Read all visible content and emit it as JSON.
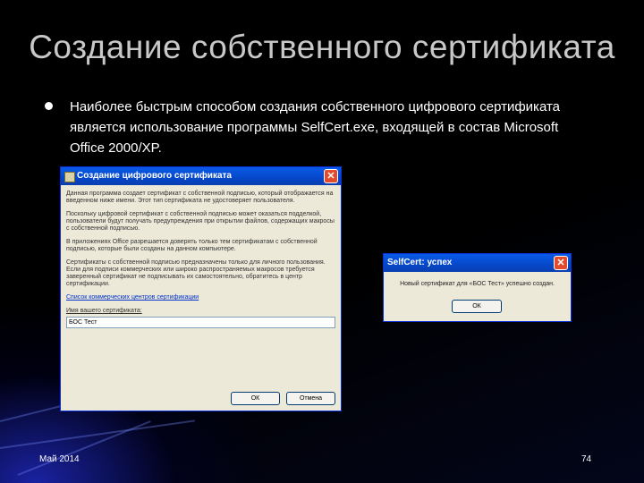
{
  "slide": {
    "title": "Создание собственного сертификата",
    "bullet": "Наиболее быстрым способом создания собственного цифрового сертификата является использование программы SelfCert.exe, входящей в состав Microsoft Office 2000/XP.",
    "footer_date": "Май 2014",
    "page_number": "74"
  },
  "create_dialog": {
    "title": "Создание цифрового сертификата",
    "paragraphs": [
      "Данная программа создает сертификат с собственной подписью, который отображается на введенном ниже имени. Этот тип сертификата не удостоверяет пользователя.",
      "Поскольку цифровой сертификат с собственной подписью может оказаться подделкой, пользователи будут получать предупреждения при открытии файлов, содержащих макросы с собственной подписью.",
      "В приложениях Office разрешается доверять только тем сертификатам с собственной подписью, которые были созданы на данном компьютере.",
      "Сертификаты с собственной подписью предназначены только для личного пользования. Если для подписи коммерческих или широко распространяемых макросов требуется заверенный сертификат не подписывать их самостоятельно, обратитесь в центр сертификации."
    ],
    "link_text": "Список коммерческих центров сертификации",
    "name_label": "Имя вашего сертификата:",
    "name_value": "БОС Тест",
    "ok_label": "ОК",
    "cancel_label": "Отмена"
  },
  "success_dialog": {
    "title": "SelfCert: успех",
    "message": "Новый сертификат для «БОС Тест» успешно создан.",
    "ok_label": "ОК"
  },
  "icons": {
    "close": "close-icon",
    "bullet": "bullet-icon",
    "app": "certificate-icon"
  },
  "colors": {
    "xp_title_blue": "#0a5be8",
    "xp_face": "#ece9d8",
    "close_red": "#e34b2d"
  }
}
